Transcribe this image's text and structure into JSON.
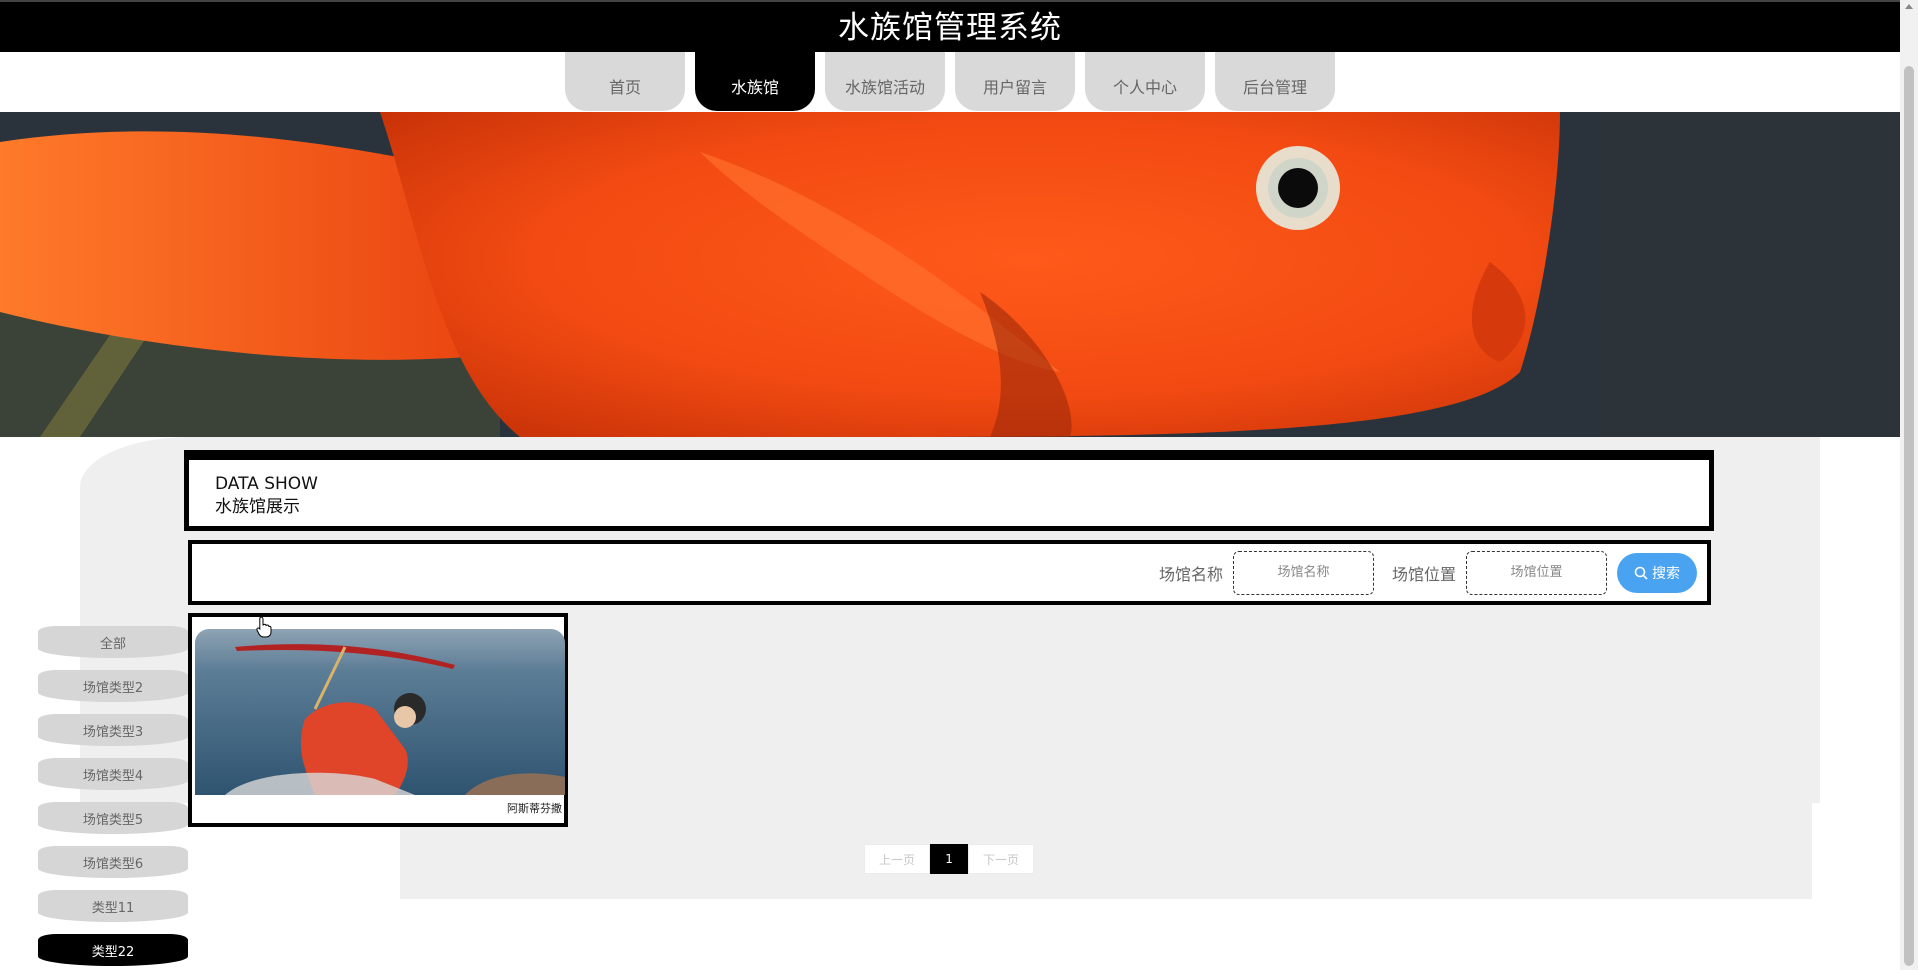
{
  "header": {
    "title": "水族馆管理系统"
  },
  "nav": {
    "items": [
      {
        "label": "首页"
      },
      {
        "label": "水族馆"
      },
      {
        "label": "水族馆活动"
      },
      {
        "label": "用户留言"
      },
      {
        "label": "个人中心"
      },
      {
        "label": "后台管理"
      }
    ],
    "active_index": 1
  },
  "banner": {
    "slides": 3,
    "active_slide": 1
  },
  "data_show": {
    "en_title": "DATA SHOW",
    "cn_title": "水族馆展示"
  },
  "search": {
    "name_label": "场馆名称",
    "name_placeholder": "场馆名称",
    "location_label": "场馆位置",
    "location_placeholder": "场馆位置",
    "button_label": "搜索"
  },
  "sidebar": {
    "items": [
      {
        "label": "全部"
      },
      {
        "label": "场馆类型2"
      },
      {
        "label": "场馆类型3"
      },
      {
        "label": "场馆类型4"
      },
      {
        "label": "场馆类型5"
      },
      {
        "label": "场馆类型6"
      },
      {
        "label": "类型11"
      },
      {
        "label": "类型22"
      }
    ],
    "active_index": 7
  },
  "cards": [
    {
      "title": "阿斯蒂芬撒"
    }
  ],
  "pagination": {
    "prev": "上一页",
    "current": "1",
    "next": "下一页"
  },
  "colors": {
    "header_bg": "#000000",
    "active": "#000000",
    "accent_green": "#22b573",
    "search_button": "#4aa3f0"
  }
}
